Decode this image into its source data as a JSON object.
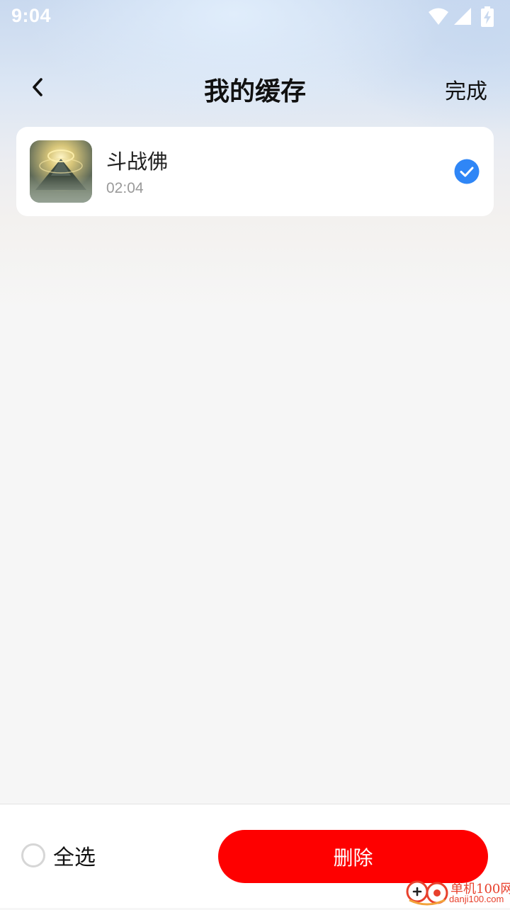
{
  "status_bar": {
    "time": "9:04",
    "icons": [
      "wifi-icon",
      "signal-icon",
      "battery-charging-icon"
    ]
  },
  "header": {
    "title": "我的缓存",
    "done_label": "完成"
  },
  "cache_items": [
    {
      "title": "斗战佛",
      "duration": "02:04",
      "selected": true,
      "thumbnail": "mountain-light-thumbnail"
    }
  ],
  "footer": {
    "select_all_label": "全选",
    "select_all_checked": false,
    "delete_label": "删除"
  },
  "watermark": {
    "name": "单机100网",
    "url": "danji100.com"
  },
  "colors": {
    "accent_blue": "#2f86f6",
    "delete_red": "#fe0000",
    "watermark_red": "#e8402c"
  }
}
